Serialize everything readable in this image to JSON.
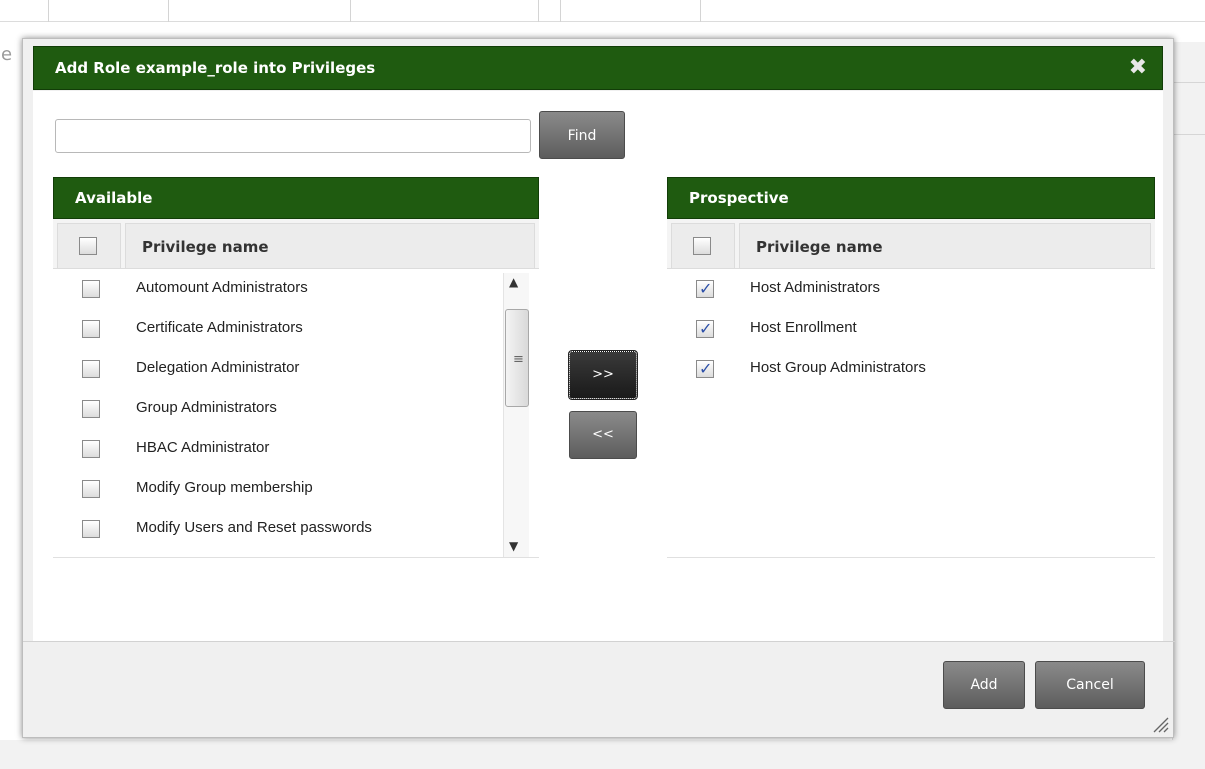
{
  "background": {
    "left_letter": "e"
  },
  "dialog": {
    "title": "Add Role example_role into Privileges",
    "close_icon": "✖"
  },
  "search": {
    "value": "",
    "placeholder": "",
    "find_label": "Find"
  },
  "available": {
    "header": "Available",
    "column_header": "Privilege name",
    "items": [
      {
        "label": "Automount Administrators",
        "checked": false
      },
      {
        "label": "Certificate Administrators",
        "checked": false
      },
      {
        "label": "Delegation Administrator",
        "checked": false
      },
      {
        "label": "Group Administrators",
        "checked": false
      },
      {
        "label": "HBAC Administrator",
        "checked": false
      },
      {
        "label": "Modify Group membership",
        "checked": false
      },
      {
        "label": "Modify Users and Reset passwords",
        "checked": false
      }
    ],
    "scroll": {
      "up_icon": "▲",
      "down_icon": "▼",
      "grip_icon": "≡"
    }
  },
  "move": {
    "add_label": ">>",
    "remove_label": "<<"
  },
  "prospective": {
    "header": "Prospective",
    "column_header": "Privilege name",
    "items": [
      {
        "label": "Host Administrators",
        "checked": true
      },
      {
        "label": "Host Enrollment",
        "checked": true
      },
      {
        "label": "Host Group Administrators",
        "checked": true
      }
    ]
  },
  "footer": {
    "add_label": "Add",
    "cancel_label": "Cancel"
  },
  "colors": {
    "header_green": "#1f5b10",
    "button_grey": "#6b6b6b",
    "check_blue": "#2c4fa8"
  }
}
